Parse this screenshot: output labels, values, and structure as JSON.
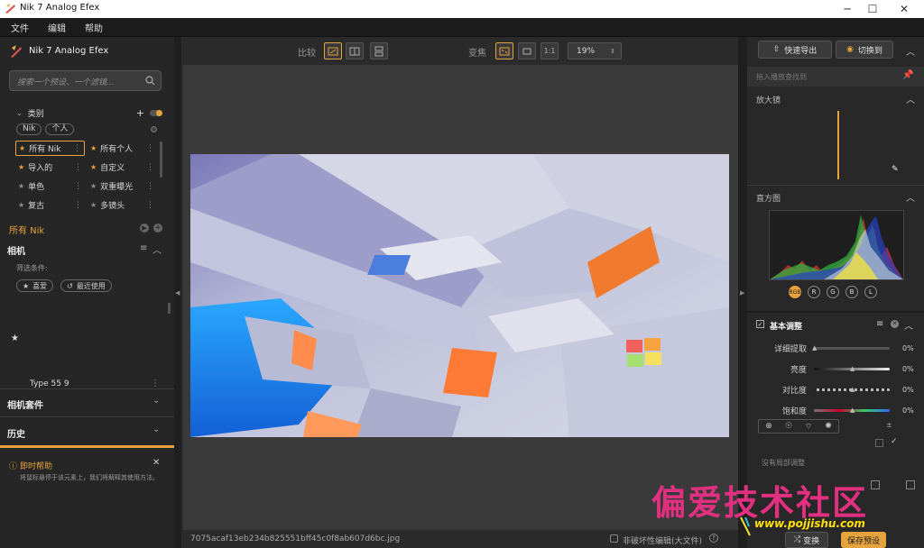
{
  "window": {
    "title": "Nik 7 Analog Efex"
  },
  "menu": [
    "文件",
    "编辑",
    "帮助"
  ],
  "left": {
    "app_name": "Nik 7 Analog Efex",
    "search_placeholder": "搜索一个预设、一个滤镜...",
    "categories_label": "类别",
    "chips": [
      "Nik",
      "个人"
    ],
    "presets": [
      {
        "label": "所有 Nik",
        "star": true
      },
      {
        "label": "所有个人",
        "star": true
      },
      {
        "label": "导入的",
        "star": true
      },
      {
        "label": "自定义",
        "star": true
      },
      {
        "label": "单色",
        "star": false
      },
      {
        "label": "双重曝光",
        "star": false
      },
      {
        "label": "复古",
        "star": false
      },
      {
        "label": "多镜头",
        "star": false
      }
    ],
    "current_group": "所有 Nik",
    "camera_section": "相机",
    "filter_label": "筛选条件:",
    "filter_buttons": [
      "喜爱",
      "最近使用"
    ],
    "preset_item": "Type 55 9",
    "camera_kits": "相机套件",
    "history": "历史",
    "help_title": "即时帮助",
    "help_text": "将鼠标悬停于该元素上，我们将解释其使用方法。"
  },
  "toolbar": {
    "compare_label": "比较",
    "zoom_label": "变焦",
    "one_to_one": "1:1",
    "zoom_value": "19%"
  },
  "status": {
    "filename": "7075acaf13eb234b825551bff45c0f8ab607d6bc.jpg",
    "nondestructive": "非破坏性编辑(大文件)"
  },
  "right": {
    "export_button": "快速导出",
    "switch_button": "切换到",
    "loupe_hint": "拖入播放查找到",
    "loupe_label": "放大镜",
    "histogram_label": "直方图",
    "channels": [
      "RGB",
      "R",
      "G",
      "B",
      "L"
    ],
    "basic_label": "基本调整",
    "sliders": [
      {
        "label": "详细提取",
        "value": "0%",
        "level": 0.0
      },
      {
        "label": "亮度",
        "value": "0%",
        "level": 0.5
      },
      {
        "label": "对比度",
        "value": "0%",
        "level": 0.5
      },
      {
        "label": "饱和度",
        "value": "0%",
        "level": 0.5
      }
    ],
    "no_local": "没有局部调整",
    "shuffle_button": "变换",
    "save_button": "保存预设"
  },
  "watermark": {
    "text": "偏爱技术社区",
    "url": "www.pojjishu.com"
  },
  "colors": {
    "accent": "#e6a23c",
    "titlebar": "#ffffff",
    "panel": "#262626"
  }
}
